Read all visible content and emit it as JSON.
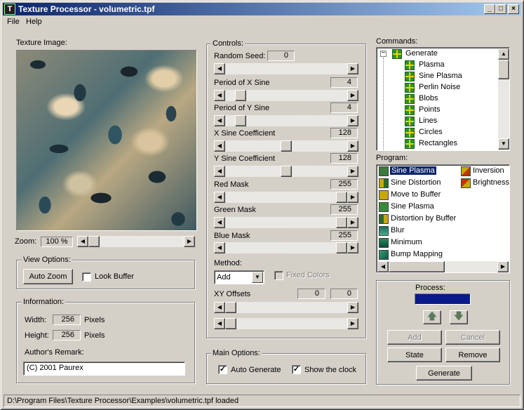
{
  "window": {
    "title": "Texture Processor - volumetric.tpf",
    "app_icon": "T",
    "minimize": "_",
    "maximize": "□",
    "close": "×"
  },
  "menu": {
    "file": "File",
    "help": "Help"
  },
  "texture": {
    "label": "Texture Image:",
    "zoom_label": "Zoom:",
    "zoom_value": "100 %"
  },
  "view_options": {
    "title": "View Options:",
    "auto_zoom": "Auto Zoom",
    "look_buffer": "Look Buffer",
    "look_buffer_checked": false
  },
  "information": {
    "title": "Information:",
    "width_label": "Width:",
    "width_value": "256",
    "width_unit": "Pixels",
    "height_label": "Height:",
    "height_value": "256",
    "height_unit": "Pixels",
    "remark_label": "Author's Remark:",
    "remark_value": "(C) 2001 Paurex"
  },
  "controls": {
    "title": "Controls:",
    "random_seed_label": "Random Seed:",
    "random_seed_value": "0",
    "period_x_label": "Period of X Sine",
    "period_x_value": "4",
    "period_y_label": "Period of Y Sine",
    "period_y_value": "4",
    "x_coef_label": "X Sine Coefficient",
    "x_coef_value": "128",
    "y_coef_label": "Y Sine Coefficient",
    "y_coef_value": "128",
    "red_label": "Red Mask",
    "red_value": "255",
    "green_label": "Green Mask",
    "green_value": "255",
    "blue_label": "Blue Mask",
    "blue_value": "255",
    "method_label": "Method:",
    "method_value": "Add",
    "fixed_colors": "Fixed Colors",
    "xy_label": "XY Offsets",
    "xy_x": "0",
    "xy_y": "0"
  },
  "main_options": {
    "title": "Main Options:",
    "auto_generate": "Auto Generate",
    "show_clock": "Show the clock",
    "auto_generate_checked": true,
    "show_clock_checked": true
  },
  "commands": {
    "title": "Commands:",
    "root": "Generate",
    "items": [
      "Plasma",
      "Sine Plasma",
      "Perlin Noise",
      "Blobs",
      "Points",
      "Lines",
      "Circles",
      "Rectangles"
    ]
  },
  "program": {
    "title": "Program:",
    "col1": [
      "Sine Plasma",
      "Sine Distortion",
      "Move to Buffer",
      "Sine Plasma",
      "Distortion by Buffer",
      "Blur",
      "Minimum",
      "Bump Mapping"
    ],
    "col2": [
      "Inversion",
      "Brightness"
    ]
  },
  "process": {
    "title": "Process:",
    "up_arrow": "🡅",
    "down_arrow": "🡇",
    "add": "Add",
    "cancel": "Cancel",
    "state": "State",
    "remove": "Remove",
    "generate": "Generate"
  },
  "status": {
    "text": "D:\\Program Files\\Texture Processor\\Examples\\volumetric.tpf loaded"
  },
  "glyphs": {
    "left": "◀",
    "right": "▶",
    "up": "▲",
    "down": "▼",
    "check": "✓",
    "minus": "−"
  }
}
